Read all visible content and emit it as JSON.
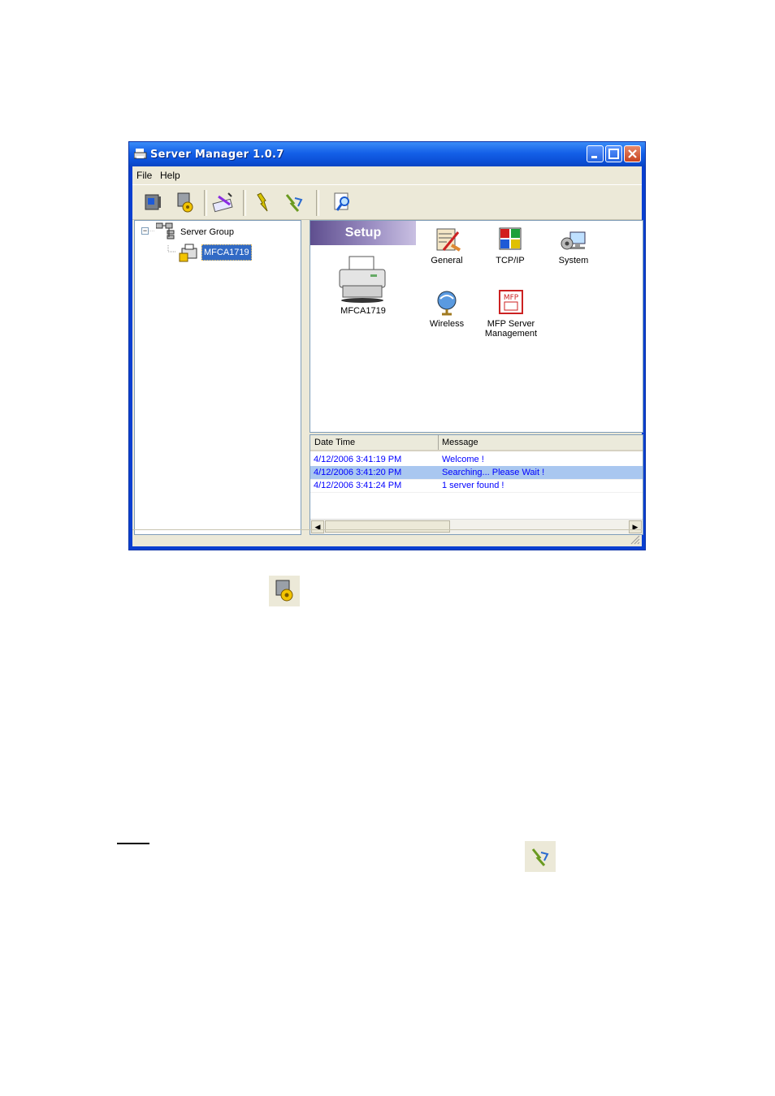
{
  "window": {
    "title": "Server Manager 1.0.7"
  },
  "menu": {
    "file": "File",
    "help": "Help"
  },
  "toolbar": {
    "buttons": [
      "connect-icon",
      "setup-icon",
      "configure-icon",
      "flash-icon",
      "reset-icon",
      "search-icon"
    ]
  },
  "tree": {
    "root_label": "Server Group",
    "child_label": "MFCA1719",
    "expander": "−"
  },
  "setup": {
    "banner": "Setup",
    "device_label": "MFCA1719",
    "items": [
      {
        "label": "General"
      },
      {
        "label": "TCP/IP"
      },
      {
        "label": "System"
      },
      {
        "label": "Wireless"
      },
      {
        "label_line1": "MFP Server",
        "label_line2": "Management"
      }
    ]
  },
  "log": {
    "headers": {
      "datetime": "Date Time",
      "message": "Message"
    },
    "rows": [
      {
        "datetime": "4/12/2006 3:41:19 PM",
        "message": "Welcome !"
      },
      {
        "datetime": "4/12/2006 3:41:20 PM",
        "message": "Searching... Please Wait !"
      },
      {
        "datetime": "4/12/2006 3:41:24 PM",
        "message": "1 server found !"
      }
    ],
    "selected_row": 1
  },
  "colors": {
    "titlebar": "#0b4fd6",
    "selection": "#316ac5",
    "log_text": "#0000ff"
  }
}
